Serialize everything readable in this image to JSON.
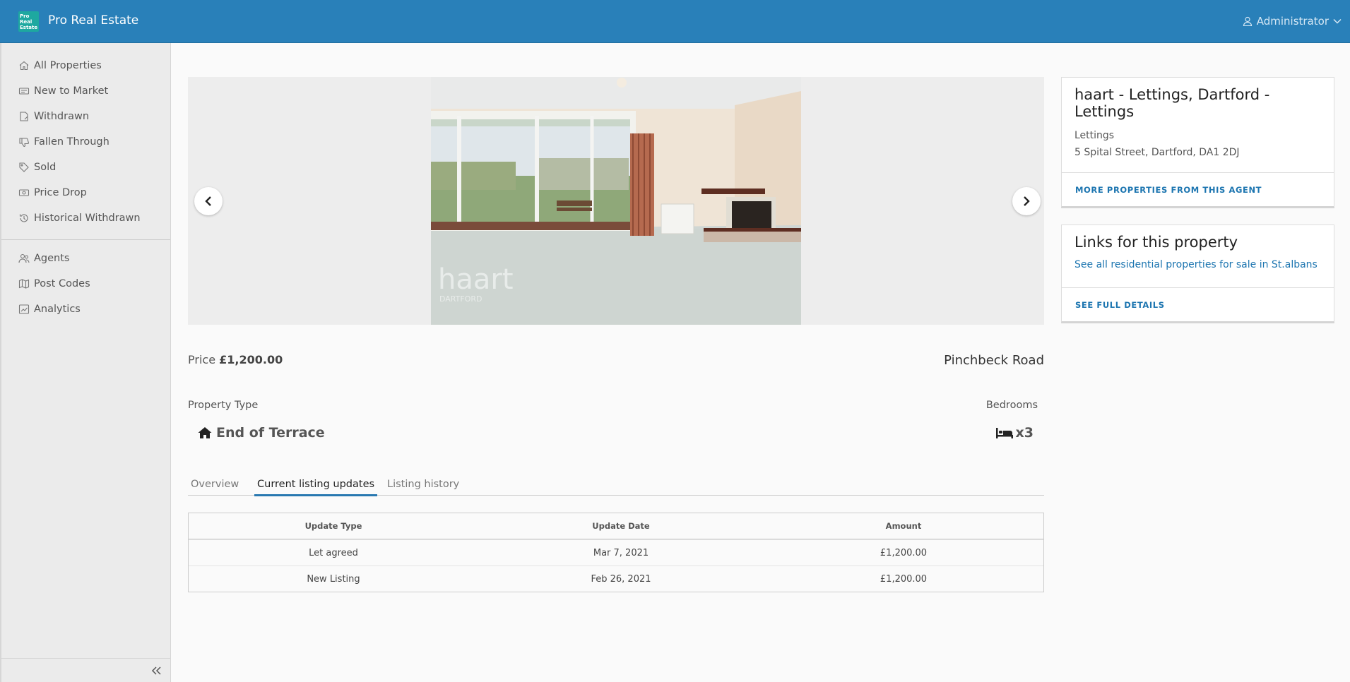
{
  "header": {
    "logo_lines": [
      "Pro",
      "Real",
      "Estate"
    ],
    "title": "Pro Real Estate",
    "user": "Administrator"
  },
  "sidebar": {
    "primary": [
      {
        "label": "All Properties",
        "icon": "home-icon"
      },
      {
        "label": "New to Market",
        "icon": "card-icon"
      },
      {
        "label": "Withdrawn",
        "icon": "document-icon"
      },
      {
        "label": "Fallen Through",
        "icon": "thumbs-down-icon"
      },
      {
        "label": "Sold",
        "icon": "tag-icon"
      },
      {
        "label": "Price Drop",
        "icon": "banknote-icon"
      },
      {
        "label": "Historical Withdrawn",
        "icon": "history-icon"
      }
    ],
    "secondary": [
      {
        "label": "Agents",
        "icon": "users-icon"
      },
      {
        "label": "Post Codes",
        "icon": "map-icon"
      },
      {
        "label": "Analytics",
        "icon": "chart-icon"
      }
    ]
  },
  "listing": {
    "price_label": "Price",
    "price_value": "£1,200.00",
    "address": "Pinchbeck Road",
    "property_type_label": "Property Type",
    "property_type_value": "End of Terrace",
    "bedrooms_label": "Bedrooms",
    "bedrooms_value": "x3",
    "photo_watermark": "haart",
    "photo_watermark_sub": "DARTFORD"
  },
  "tabs": [
    {
      "label": "Overview",
      "active": false
    },
    {
      "label": "Current listing updates",
      "active": true
    },
    {
      "label": "Listing history",
      "active": false
    }
  ],
  "updates_table": {
    "headers": [
      "Update Type",
      "Update Date",
      "Amount"
    ],
    "rows": [
      [
        "Let agreed",
        "Mar 7, 2021",
        "£1,200.00"
      ],
      [
        "New Listing",
        "Feb 26, 2021",
        "£1,200.00"
      ]
    ]
  },
  "agent_card": {
    "title": "haart - Lettings, Dartford - Lettings",
    "category": "Lettings",
    "address": "5 Spital Street, Dartford, DA1 2DJ",
    "action": "MORE PROPERTIES FROM THIS AGENT"
  },
  "links_card": {
    "title": "Links for this property",
    "link": "See all residential properties for sale in St.albans",
    "action": "SEE FULL DETAILS"
  },
  "colors": {
    "header": "#2980b9",
    "accent": "#1c75b0",
    "logo": "#1ea8a0"
  }
}
